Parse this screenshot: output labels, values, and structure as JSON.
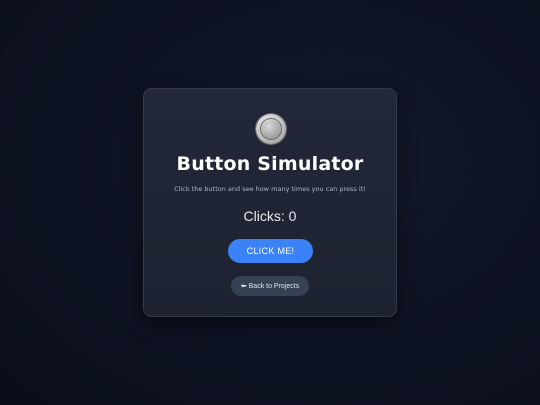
{
  "card": {
    "title": "Button Simulator",
    "subtitle": "Click the button and see how many times you can press it!",
    "clicks_label": "Clicks: 0",
    "click_button_label": "CLICK ME!",
    "back_arrow": "⬅",
    "back_label": "Back to Projects",
    "logo_icon": "round-button-icon"
  },
  "colors": {
    "background": "#0d1222",
    "card": "#1f2533",
    "accent": "#3b82f6",
    "secondary_button": "#374154"
  }
}
